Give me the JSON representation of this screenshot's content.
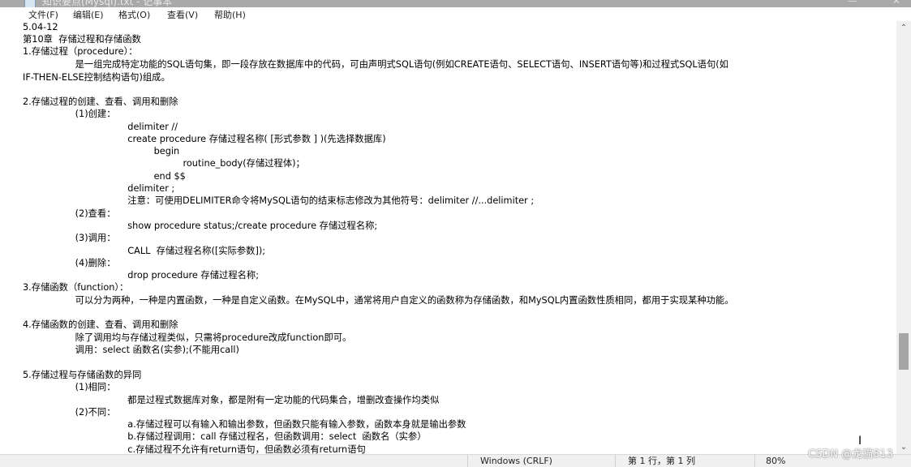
{
  "window": {
    "title": "知识要点(Mysql).txt - 记事本"
  },
  "menu": [
    {
      "label": "文件(F)"
    },
    {
      "label": "编辑(E)"
    },
    {
      "label": "格式(O)"
    },
    {
      "label": "查看(V)"
    },
    {
      "label": "帮助(H)"
    }
  ],
  "lines": [
    "5.04-12",
    "第10章  存储过程和存储函数",
    "1.存储过程（procedure）：",
    "                  是一组完成特定功能的SQL语句集，即一段存放在数据库中的代码，可由声明式SQL语句(例如CREATE语句、SELECT语句、INSERT语句等)和过程式SQL语句(如",
    "IF-THEN-ELSE控制结构语句)组成。",
    "",
    "2.存储过程的创建、查看、调用和删除",
    "                  (1)创建：",
    "                                    delimiter //",
    "                                    create procedure 存储过程名称( [形式参数 ] )(先选择数据库)",
    "                                             begin",
    "                                                       routine_body(存储过程体)；",
    "                                             end $$",
    "                                    delimiter ;",
    "                                    注意：可使用DELIMITER命令将MySQL语句的结束标志修改为其他符号：delimiter //...delimiter ;",
    "                  (2)查看：",
    "                                    show procedure status;/create procedure 存储过程名称;",
    "                  (3)调用：",
    "                                    CALL  存储过程名称([实际参数]);",
    "                  (4)删除：",
    "                                    drop procedure 存储过程名称;",
    "3.存储函数（function）：",
    "                  可以分为两种，一种是内置函数，一种是自定义函数。在MySQL中，通常将用户自定义的函数称为存储函数，和MySQL内置函数性质相同，都用于实现某种功能。",
    "",
    "4.存储函数的创建、查看、调用和删除",
    "                  除了调用均与存储过程类似，只需将procedure改成function即可。",
    "                  调用：select 函数名(实参);(不能用call)",
    "",
    "5.存储过程与存储函数的异同",
    "                  (1)相同：",
    "                                    都是过程式数据库对象，都是附有一定功能的代码集合，增删改查操作均类似",
    "                  (2)不同：",
    "                                    a.存储过程可以有输入和输出参数，但函数只能有输入参数，函数本身就是输出参数",
    "                                    b.存储过程调用：call 存储过程名，但函数调用：select  函数名（实参）",
    "                                    c.存储过程不允许有return语句，但函数必须有return语句"
  ],
  "status": {
    "encoding_line_ending": "Windows (CRLF)",
    "position": "第 1 行，第 1 列",
    "zoom": "80%"
  },
  "watermark": "CSDN @龙猫813",
  "scroll": {
    "up_arrow": "⌃",
    "down_arrow": "⌄"
  }
}
